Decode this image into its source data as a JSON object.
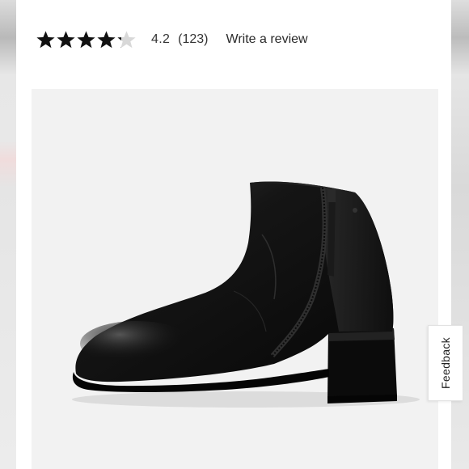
{
  "rating": {
    "value": "4.2",
    "count": "(123)",
    "stars_filled": 4.2,
    "stars_total": 5,
    "write_review_label": "Write a review"
  },
  "feedback": {
    "label": "Feedback"
  },
  "product_image": {
    "subject": "black leather ankle boot with side zip and block heel",
    "background": "#f2f2f2"
  },
  "colors": {
    "star_filled": "#111111",
    "star_empty": "#d8d8d8",
    "text": "#333333"
  }
}
